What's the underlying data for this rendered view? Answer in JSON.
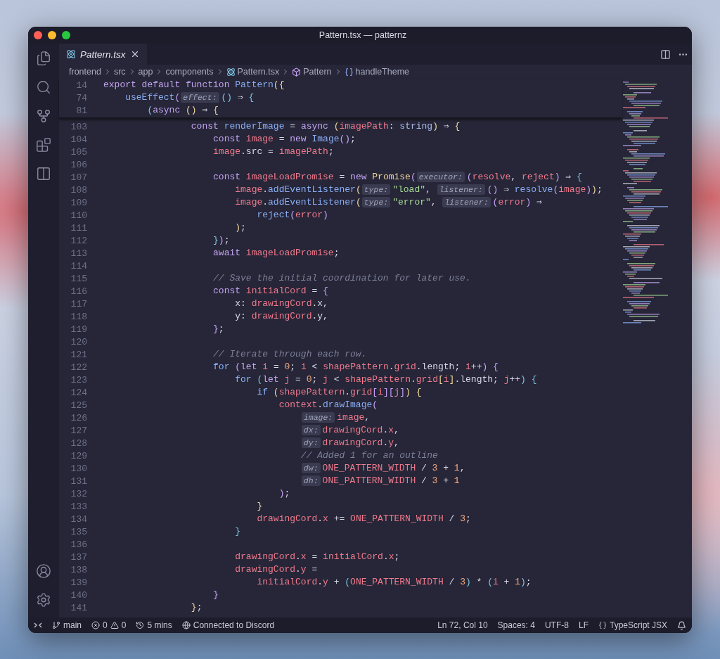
{
  "window": {
    "title": "Pattern.tsx — patternz"
  },
  "tabs": [
    {
      "label": "Pattern.tsx",
      "selected": true
    }
  ],
  "breadcrumb": [
    {
      "label": "frontend",
      "kind": "folder"
    },
    {
      "label": "src",
      "kind": "folder"
    },
    {
      "label": "app",
      "kind": "folder"
    },
    {
      "label": "components",
      "kind": "folder"
    },
    {
      "label": "Pattern.tsx",
      "kind": "file"
    },
    {
      "label": "Pattern",
      "kind": "symbol"
    },
    {
      "label": "handleTheme",
      "kind": "variable"
    }
  ],
  "sticky_lines": [
    {
      "n": "14",
      "tokens": [
        {
          "kind": "kw",
          "text": "export default function "
        },
        {
          "kind": "fn",
          "text": "Pattern"
        },
        {
          "kind": "b1",
          "text": "({"
        }
      ]
    },
    {
      "n": "74",
      "tokens": [
        {
          "kind": "fn",
          "text": "    useEffect"
        },
        {
          "kind": "b2",
          "text": "("
        },
        {
          "kind": "hint",
          "text": "effect:"
        },
        {
          "kind": "b3",
          "text": "()"
        },
        {
          "kind": "op",
          "text": " ⇒ "
        },
        {
          "kind": "b3",
          "text": "{"
        }
      ]
    },
    {
      "n": "81",
      "tokens": [
        {
          "kind": "b3",
          "text": "        ("
        },
        {
          "kind": "kw",
          "text": "async "
        },
        {
          "kind": "b1",
          "text": "()"
        },
        {
          "kind": "op",
          "text": " ⇒ "
        },
        {
          "kind": "b1",
          "text": "{"
        }
      ]
    }
  ],
  "lines": [
    {
      "n": "103",
      "tokens": [
        {
          "kind": "kw",
          "text": "                const "
        },
        {
          "kind": "fn",
          "text": "renderImage"
        },
        {
          "kind": "op",
          "text": " = "
        },
        {
          "kind": "kw",
          "text": "async "
        },
        {
          "kind": "b1",
          "text": "("
        },
        {
          "kind": "var",
          "text": "imagePath"
        },
        {
          "kind": "op",
          "text": ": "
        },
        {
          "kind": "type",
          "text": "string"
        },
        {
          "kind": "b1",
          "text": ")"
        },
        {
          "kind": "op",
          "text": " ⇒ "
        },
        {
          "kind": "b1",
          "text": "{"
        }
      ]
    },
    {
      "n": "104",
      "tokens": [
        {
          "kind": "kw",
          "text": "                    const "
        },
        {
          "kind": "var",
          "text": "image"
        },
        {
          "kind": "op",
          "text": " = "
        },
        {
          "kind": "kw",
          "text": "new "
        },
        {
          "kind": "fn",
          "text": "Image"
        },
        {
          "kind": "b2",
          "text": "()"
        },
        {
          "kind": "op",
          "text": ";"
        }
      ]
    },
    {
      "n": "105",
      "tokens": [
        {
          "kind": "var",
          "text": "                    image"
        },
        {
          "kind": "op",
          "text": "."
        },
        {
          "kind": "prop",
          "text": "src"
        },
        {
          "kind": "op",
          "text": " = "
        },
        {
          "kind": "var",
          "text": "imagePath"
        },
        {
          "kind": "op",
          "text": ";"
        }
      ]
    },
    {
      "n": "106"
    },
    {
      "n": "107",
      "tokens": [
        {
          "kind": "kw",
          "text": "                    const "
        },
        {
          "kind": "var",
          "text": "imageLoadPromise"
        },
        {
          "kind": "op",
          "text": " = "
        },
        {
          "kind": "kw",
          "text": "new "
        },
        {
          "kind": "cls",
          "text": "Promise"
        },
        {
          "kind": "b2",
          "text": "("
        },
        {
          "kind": "hint",
          "text": "executor:"
        },
        {
          "kind": "b2",
          "text": "("
        },
        {
          "kind": "var",
          "text": "resolve"
        },
        {
          "kind": "op",
          "text": ", "
        },
        {
          "kind": "var",
          "text": "reject"
        },
        {
          "kind": "b2",
          "text": ")"
        },
        {
          "kind": "op",
          "text": " ⇒ "
        },
        {
          "kind": "b3",
          "text": "{"
        }
      ]
    },
    {
      "n": "108",
      "tokens": [
        {
          "kind": "var",
          "text": "                        image"
        },
        {
          "kind": "op",
          "text": "."
        },
        {
          "kind": "fn",
          "text": "addEventListener"
        },
        {
          "kind": "b1",
          "text": "("
        },
        {
          "kind": "hint",
          "text": "type:"
        },
        {
          "kind": "str",
          "text": "\"load\""
        },
        {
          "kind": "op",
          "text": ", "
        },
        {
          "kind": "hint",
          "text": "listener:"
        },
        {
          "kind": "b2",
          "text": "()"
        },
        {
          "kind": "op",
          "text": " ⇒ "
        },
        {
          "kind": "fn",
          "text": "resolve"
        },
        {
          "kind": "b2",
          "text": "("
        },
        {
          "kind": "var",
          "text": "image"
        },
        {
          "kind": "b2",
          "text": ")"
        },
        {
          "kind": "b1",
          "text": ")"
        },
        {
          "kind": "op",
          "text": ";"
        }
      ]
    },
    {
      "n": "109",
      "tokens": [
        {
          "kind": "var",
          "text": "                        image"
        },
        {
          "kind": "op",
          "text": "."
        },
        {
          "kind": "fn",
          "text": "addEventListener"
        },
        {
          "kind": "b1",
          "text": "("
        },
        {
          "kind": "hint",
          "text": "type:"
        },
        {
          "kind": "str",
          "text": "\"error\""
        },
        {
          "kind": "op",
          "text": ", "
        },
        {
          "kind": "hint",
          "text": "listener:"
        },
        {
          "kind": "b2",
          "text": "("
        },
        {
          "kind": "var",
          "text": "error"
        },
        {
          "kind": "b2",
          "text": ")"
        },
        {
          "kind": "op",
          "text": " ⇒"
        }
      ]
    },
    {
      "n": "110",
      "tokens": [
        {
          "kind": "fn",
          "text": "                            reject"
        },
        {
          "kind": "b2",
          "text": "("
        },
        {
          "kind": "var",
          "text": "error"
        },
        {
          "kind": "b2",
          "text": ")"
        }
      ]
    },
    {
      "n": "111",
      "tokens": [
        {
          "kind": "b1",
          "text": "                        )"
        },
        {
          "kind": "op",
          "text": ";"
        }
      ]
    },
    {
      "n": "112",
      "tokens": [
        {
          "kind": "b3",
          "text": "                    }"
        },
        {
          "kind": "b2",
          "text": ")"
        },
        {
          "kind": "op",
          "text": ";"
        }
      ]
    },
    {
      "n": "113",
      "tokens": [
        {
          "kind": "kw",
          "text": "                    await "
        },
        {
          "kind": "var",
          "text": "imageLoadPromise"
        },
        {
          "kind": "op",
          "text": ";"
        }
      ]
    },
    {
      "n": "114"
    },
    {
      "n": "115",
      "tokens": [
        {
          "kind": "cm",
          "text": "                    // Save the initial coordination for later use."
        }
      ]
    },
    {
      "n": "116",
      "tokens": [
        {
          "kind": "kw",
          "text": "                    const "
        },
        {
          "kind": "var",
          "text": "initialCord"
        },
        {
          "kind": "op",
          "text": " = "
        },
        {
          "kind": "b2",
          "text": "{"
        }
      ]
    },
    {
      "n": "117",
      "tokens": [
        {
          "kind": "prop",
          "text": "                        x"
        },
        {
          "kind": "op",
          "text": ": "
        },
        {
          "kind": "var",
          "text": "drawingCord"
        },
        {
          "kind": "op",
          "text": "."
        },
        {
          "kind": "prop",
          "text": "x"
        },
        {
          "kind": "op",
          "text": ","
        }
      ]
    },
    {
      "n": "118",
      "tokens": [
        {
          "kind": "prop",
          "text": "                        y"
        },
        {
          "kind": "op",
          "text": ": "
        },
        {
          "kind": "var",
          "text": "drawingCord"
        },
        {
          "kind": "op",
          "text": "."
        },
        {
          "kind": "prop",
          "text": "y"
        },
        {
          "kind": "op",
          "text": ","
        }
      ]
    },
    {
      "n": "119",
      "tokens": [
        {
          "kind": "b2",
          "text": "                    }"
        },
        {
          "kind": "op",
          "text": ";"
        }
      ]
    },
    {
      "n": "120"
    },
    {
      "n": "121",
      "tokens": [
        {
          "kind": "cm",
          "text": "                    // Iterate through each row."
        }
      ]
    },
    {
      "n": "122",
      "tokens": [
        {
          "kind": "ctl",
          "text": "                    for "
        },
        {
          "kind": "b2",
          "text": "("
        },
        {
          "kind": "kw",
          "text": "let "
        },
        {
          "kind": "var",
          "text": "i"
        },
        {
          "kind": "op",
          "text": " = "
        },
        {
          "kind": "num",
          "text": "0"
        },
        {
          "kind": "op",
          "text": "; "
        },
        {
          "kind": "var",
          "text": "i"
        },
        {
          "kind": "op",
          "text": " < "
        },
        {
          "kind": "var",
          "text": "shapePattern"
        },
        {
          "kind": "op",
          "text": "."
        },
        {
          "kind": "var",
          "text": "grid"
        },
        {
          "kind": "op",
          "text": "."
        },
        {
          "kind": "prop",
          "text": "length"
        },
        {
          "kind": "op",
          "text": "; "
        },
        {
          "kind": "var",
          "text": "i"
        },
        {
          "kind": "op",
          "text": "++"
        },
        {
          "kind": "b2",
          "text": ")"
        },
        {
          "kind": "b2",
          "text": " {"
        }
      ]
    },
    {
      "n": "123",
      "tokens": [
        {
          "kind": "ctl",
          "text": "                        for "
        },
        {
          "kind": "b3",
          "text": "("
        },
        {
          "kind": "kw",
          "text": "let "
        },
        {
          "kind": "var",
          "text": "j"
        },
        {
          "kind": "op",
          "text": " = "
        },
        {
          "kind": "num",
          "text": "0"
        },
        {
          "kind": "op",
          "text": "; "
        },
        {
          "kind": "var",
          "text": "j"
        },
        {
          "kind": "op",
          "text": " < "
        },
        {
          "kind": "var",
          "text": "shapePattern"
        },
        {
          "kind": "op",
          "text": "."
        },
        {
          "kind": "var",
          "text": "grid"
        },
        {
          "kind": "b1",
          "text": "["
        },
        {
          "kind": "var",
          "text": "i"
        },
        {
          "kind": "b1",
          "text": "]"
        },
        {
          "kind": "op",
          "text": "."
        },
        {
          "kind": "prop",
          "text": "length"
        },
        {
          "kind": "op",
          "text": "; "
        },
        {
          "kind": "var",
          "text": "j"
        },
        {
          "kind": "op",
          "text": "++"
        },
        {
          "kind": "b3",
          "text": ")"
        },
        {
          "kind": "b3",
          "text": " {"
        }
      ]
    },
    {
      "n": "124",
      "tokens": [
        {
          "kind": "ctl",
          "text": "                            if "
        },
        {
          "kind": "b1",
          "text": "("
        },
        {
          "kind": "var",
          "text": "shapePattern"
        },
        {
          "kind": "op",
          "text": "."
        },
        {
          "kind": "var",
          "text": "grid"
        },
        {
          "kind": "b2",
          "text": "["
        },
        {
          "kind": "var",
          "text": "i"
        },
        {
          "kind": "b2",
          "text": "]["
        },
        {
          "kind": "var",
          "text": "j"
        },
        {
          "kind": "b2",
          "text": "]"
        },
        {
          "kind": "b1",
          "text": ")"
        },
        {
          "kind": "b1",
          "text": " {"
        }
      ]
    },
    {
      "n": "125",
      "tokens": [
        {
          "kind": "var",
          "text": "                                context"
        },
        {
          "kind": "op",
          "text": "."
        },
        {
          "kind": "fn",
          "text": "drawImage"
        },
        {
          "kind": "b2",
          "text": "("
        }
      ]
    },
    {
      "n": "126",
      "tokens": [
        {
          "kind": "hint",
          "text": "                                    image:"
        },
        {
          "kind": "var",
          "text": "image"
        },
        {
          "kind": "op",
          "text": ","
        }
      ]
    },
    {
      "n": "127",
      "tokens": [
        {
          "kind": "hint",
          "text": "                                    dx:"
        },
        {
          "kind": "var",
          "text": "drawingCord"
        },
        {
          "kind": "op",
          "text": "."
        },
        {
          "kind": "var",
          "text": "x"
        },
        {
          "kind": "op",
          "text": ","
        }
      ]
    },
    {
      "n": "128",
      "tokens": [
        {
          "kind": "hint",
          "text": "                                    dy:"
        },
        {
          "kind": "var",
          "text": "drawingCord"
        },
        {
          "kind": "op",
          "text": "."
        },
        {
          "kind": "var",
          "text": "y"
        },
        {
          "kind": "op",
          "text": ","
        }
      ]
    },
    {
      "n": "129",
      "tokens": [
        {
          "kind": "cm",
          "text": "                                    // Added 1 for an outline"
        }
      ]
    },
    {
      "n": "130",
      "tokens": [
        {
          "kind": "hint",
          "text": "                                    dw:"
        },
        {
          "kind": "var",
          "text": "ONE_PATTERN_WIDTH"
        },
        {
          "kind": "op",
          "text": " / "
        },
        {
          "kind": "num",
          "text": "3"
        },
        {
          "kind": "op",
          "text": " + "
        },
        {
          "kind": "num",
          "text": "1"
        },
        {
          "kind": "op",
          "text": ","
        }
      ]
    },
    {
      "n": "131",
      "tokens": [
        {
          "kind": "hint",
          "text": "                                    dh:"
        },
        {
          "kind": "var",
          "text": "ONE_PATTERN_WIDTH"
        },
        {
          "kind": "op",
          "text": " / "
        },
        {
          "kind": "num",
          "text": "3"
        },
        {
          "kind": "op",
          "text": " + "
        },
        {
          "kind": "num",
          "text": "1"
        }
      ]
    },
    {
      "n": "132",
      "tokens": [
        {
          "kind": "b2",
          "text": "                                )"
        },
        {
          "kind": "op",
          "text": ";"
        }
      ]
    },
    {
      "n": "133",
      "tokens": [
        {
          "kind": "b1",
          "text": "                            }"
        }
      ]
    },
    {
      "n": "134",
      "tokens": [
        {
          "kind": "var",
          "text": "                            drawingCord"
        },
        {
          "kind": "op",
          "text": "."
        },
        {
          "kind": "var",
          "text": "x"
        },
        {
          "kind": "op",
          "text": " += "
        },
        {
          "kind": "var",
          "text": "ONE_PATTERN_WIDTH"
        },
        {
          "kind": "op",
          "text": " / "
        },
        {
          "kind": "num",
          "text": "3"
        },
        {
          "kind": "op",
          "text": ";"
        }
      ]
    },
    {
      "n": "135",
      "tokens": [
        {
          "kind": "b3",
          "text": "                        }"
        }
      ]
    },
    {
      "n": "136"
    },
    {
      "n": "137",
      "tokens": [
        {
          "kind": "var",
          "text": "                        drawingCord"
        },
        {
          "kind": "op",
          "text": "."
        },
        {
          "kind": "var",
          "text": "x"
        },
        {
          "kind": "op",
          "text": " = "
        },
        {
          "kind": "var",
          "text": "initialCord"
        },
        {
          "kind": "op",
          "text": "."
        },
        {
          "kind": "var",
          "text": "x"
        },
        {
          "kind": "op",
          "text": ";"
        }
      ]
    },
    {
      "n": "138",
      "tokens": [
        {
          "kind": "var",
          "text": "                        drawingCord"
        },
        {
          "kind": "op",
          "text": "."
        },
        {
          "kind": "var",
          "text": "y"
        },
        {
          "kind": "op",
          "text": " ="
        }
      ]
    },
    {
      "n": "139",
      "tokens": [
        {
          "kind": "var",
          "text": "                            initialCord"
        },
        {
          "kind": "op",
          "text": "."
        },
        {
          "kind": "var",
          "text": "y"
        },
        {
          "kind": "op",
          "text": " + "
        },
        {
          "kind": "b3",
          "text": "("
        },
        {
          "kind": "var",
          "text": "ONE_PATTERN_WIDTH"
        },
        {
          "kind": "op",
          "text": " / "
        },
        {
          "kind": "num",
          "text": "3"
        },
        {
          "kind": "b3",
          "text": ")"
        },
        {
          "kind": "op",
          "text": " * "
        },
        {
          "kind": "b3",
          "text": "("
        },
        {
          "kind": "var",
          "text": "i"
        },
        {
          "kind": "op",
          "text": " + "
        },
        {
          "kind": "num",
          "text": "1"
        },
        {
          "kind": "b3",
          "text": ")"
        },
        {
          "kind": "op",
          "text": ";"
        }
      ]
    },
    {
      "n": "140",
      "tokens": [
        {
          "kind": "b2",
          "text": "                    }"
        }
      ]
    },
    {
      "n": "141",
      "tokens": [
        {
          "kind": "b1",
          "text": "                }"
        },
        {
          "kind": "op",
          "text": ";"
        }
      ]
    }
  ],
  "status_bar": {
    "branch": "main",
    "errors": "0",
    "warnings": "0",
    "time": "5 mins",
    "presence": "Connected to Discord",
    "position": "Ln 72, Col 10",
    "spaces": "Spaces: 4",
    "encoding": "UTF-8",
    "eol": "LF",
    "language": "TypeScript JSX"
  }
}
